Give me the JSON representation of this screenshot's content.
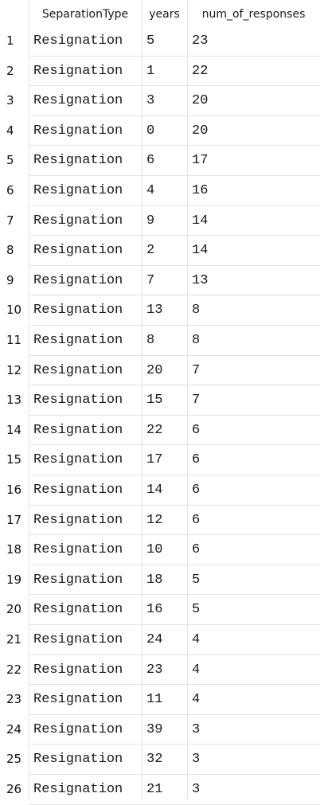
{
  "table": {
    "columns": [
      "SeparationType",
      "years",
      "num_of_responses"
    ],
    "rows": [
      {
        "n": "1",
        "type": "Resignation",
        "years": "5",
        "num": "23"
      },
      {
        "n": "2",
        "type": "Resignation",
        "years": "1",
        "num": "22"
      },
      {
        "n": "3",
        "type": "Resignation",
        "years": "3",
        "num": "20"
      },
      {
        "n": "4",
        "type": "Resignation",
        "years": "0",
        "num": "20"
      },
      {
        "n": "5",
        "type": "Resignation",
        "years": "6",
        "num": "17"
      },
      {
        "n": "6",
        "type": "Resignation",
        "years": "4",
        "num": "16"
      },
      {
        "n": "7",
        "type": "Resignation",
        "years": "9",
        "num": "14"
      },
      {
        "n": "8",
        "type": "Resignation",
        "years": "2",
        "num": "14"
      },
      {
        "n": "9",
        "type": "Resignation",
        "years": "7",
        "num": "13"
      },
      {
        "n": "10",
        "type": "Resignation",
        "years": "13",
        "num": "8"
      },
      {
        "n": "11",
        "type": "Resignation",
        "years": "8",
        "num": "8"
      },
      {
        "n": "12",
        "type": "Resignation",
        "years": "20",
        "num": "7"
      },
      {
        "n": "13",
        "type": "Resignation",
        "years": "15",
        "num": "7"
      },
      {
        "n": "14",
        "type": "Resignation",
        "years": "22",
        "num": "6"
      },
      {
        "n": "15",
        "type": "Resignation",
        "years": "17",
        "num": "6"
      },
      {
        "n": "16",
        "type": "Resignation",
        "years": "14",
        "num": "6"
      },
      {
        "n": "17",
        "type": "Resignation",
        "years": "12",
        "num": "6"
      },
      {
        "n": "18",
        "type": "Resignation",
        "years": "10",
        "num": "6"
      },
      {
        "n": "19",
        "type": "Resignation",
        "years": "18",
        "num": "5"
      },
      {
        "n": "20",
        "type": "Resignation",
        "years": "16",
        "num": "5"
      },
      {
        "n": "21",
        "type": "Resignation",
        "years": "24",
        "num": "4"
      },
      {
        "n": "22",
        "type": "Resignation",
        "years": "23",
        "num": "4"
      },
      {
        "n": "23",
        "type": "Resignation",
        "years": "11",
        "num": "4"
      },
      {
        "n": "24",
        "type": "Resignation",
        "years": "39",
        "num": "3"
      },
      {
        "n": "25",
        "type": "Resignation",
        "years": "32",
        "num": "3"
      },
      {
        "n": "26",
        "type": "Resignation",
        "years": "21",
        "num": "3"
      }
    ]
  },
  "colors": {
    "background": "#ffffff",
    "gridline": "#e3e3e3",
    "text": "#1a1a1a"
  }
}
